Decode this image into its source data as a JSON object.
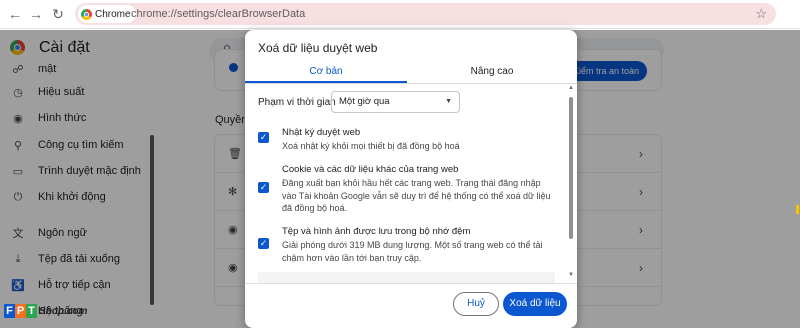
{
  "browser": {
    "chip_label": "Chrome",
    "url": "chrome://settings/clearBrowserData"
  },
  "settings": {
    "title": "Cài đặt",
    "sidebar": [
      {
        "label": "mật",
        "icon": "shield-icon"
      },
      {
        "label": "Hiệu suất",
        "icon": "speed-icon"
      },
      {
        "label": "Hình thức",
        "icon": "palette-icon"
      },
      {
        "label": "Công cụ tìm kiếm",
        "icon": "search-icon"
      },
      {
        "label": "Trình duyệt mặc định",
        "icon": "browser-icon"
      },
      {
        "label": "Khi khởi động",
        "icon": "power-icon"
      },
      {
        "label": "Ngôn ngữ",
        "icon": "translate-icon"
      },
      {
        "label": "Tệp đã tải xuống",
        "icon": "download-icon"
      },
      {
        "label": "Hỗ trợ tiếp cận",
        "icon": "accessibility-icon"
      },
      {
        "label": "Hệ thống",
        "icon": "wrench-icon"
      }
    ],
    "section_title": "Quyền",
    "button_partial": "Kiểm tra an toàn"
  },
  "watermark": {
    "letters": [
      "F",
      "P",
      "T"
    ],
    "text": "Shop.com"
  },
  "dialog": {
    "title": "Xoá dữ liệu duyệt web",
    "tabs": [
      {
        "label": "Cơ bản",
        "active": true
      },
      {
        "label": "Nâng cao",
        "active": false
      }
    ],
    "time_range": {
      "label": "Phạm vi thời gian",
      "value": "Một giờ qua"
    },
    "options": [
      {
        "title": "Nhật ký duyệt web",
        "description": "Xoá nhật ký khỏi mọi thiết bị đã đồng bộ hoá",
        "checked": true
      },
      {
        "title": "Cookie và các dữ liệu khác của trang web",
        "description": "Đăng xuất bạn khỏi hầu hết các trang web. Trạng thái đăng nhập vào Tài khoản Google vẫn sẽ duy trì để hệ thống có thể xoá dữ liệu đã đồng bộ hoá.",
        "checked": true
      },
      {
        "title": "Tệp và hình ảnh được lưu trong bộ nhớ đệm",
        "description": "Giải phóng dưới 319 MB dung lượng. Một số trang web có thể tải chậm hơn vào lần tới bạn truy cập.",
        "checked": true
      }
    ],
    "cancel_label": "Huỷ",
    "confirm_label": "Xoá dữ liệu"
  },
  "colors": {
    "accent": "#0b57d0",
    "omnibox": "#f7dfe2"
  }
}
